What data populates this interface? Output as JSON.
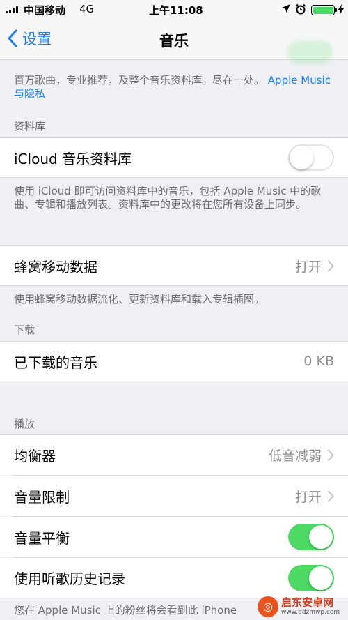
{
  "status_bar": {
    "carrier": "中国移动",
    "network": "4G",
    "time": "上午11:08",
    "battery_color": "#4cd964"
  },
  "nav": {
    "back_label": "设置",
    "title": "音乐"
  },
  "top_note": {
    "text": "百万歌曲，专业推荐，及整个音乐资料库。尽在一处。",
    "link": "Apple Music 与隐私"
  },
  "library_section": {
    "header": "资料库",
    "icloud_label": "iCloud 音乐资料库",
    "icloud_enabled": false,
    "footer": "使用 iCloud 即可访问资料库中的音乐，包括 Apple Music 中的歌曲、专辑和播放列表。资料库中的更改将在您所有设备上同步。"
  },
  "cellular": {
    "label": "蜂窝移动数据",
    "value": "打开",
    "footer": "使用蜂窝移动数据流化、更新资料库和载入专辑插图。"
  },
  "downloads_section": {
    "header": "下载",
    "label": "已下载的音乐",
    "value": "0 KB"
  },
  "playback_section": {
    "header": "播放",
    "eq_label": "均衡器",
    "eq_value": "低音减弱",
    "volume_limit_label": "音量限制",
    "volume_limit_value": "打开",
    "sound_check_label": "音量平衡",
    "sound_check_enabled": true,
    "history_label": "使用听歌历史记录",
    "history_enabled": true,
    "footer": "您在 Apple Music 上的粉丝将会看到此 iPhone"
  },
  "watermark": {
    "name": "启东安卓网",
    "url": "www.qdzmwp.com"
  },
  "colors": {
    "accent": "#1d7ff0",
    "toggle_on": "#4cd964",
    "background": "#efeff4"
  }
}
